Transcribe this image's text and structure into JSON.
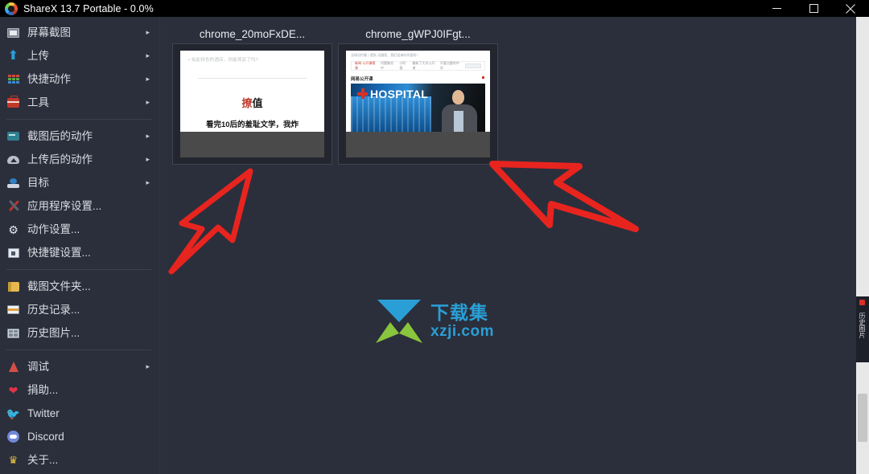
{
  "window": {
    "title": "ShareX 13.7 Portable - 0.0%",
    "app_icon": "sharex-logo-icon",
    "controls": {
      "minimize": "minimize-button",
      "maximize": "maximize-button",
      "close": "close-button"
    }
  },
  "sidebar": {
    "groups": [
      {
        "items": [
          {
            "label": "屏幕截图",
            "icon": "screenshot-icon",
            "submenu": true
          },
          {
            "label": "上传",
            "icon": "upload-arrow-icon",
            "submenu": true
          },
          {
            "label": "快捷动作",
            "icon": "quick-actions-grid-icon",
            "submenu": true
          },
          {
            "label": "工具",
            "icon": "toolbox-icon",
            "submenu": true
          }
        ]
      },
      {
        "items": [
          {
            "label": "截图后的动作",
            "icon": "after-capture-tag-icon",
            "submenu": true
          },
          {
            "label": "上传后的动作",
            "icon": "after-upload-cloud-icon",
            "submenu": true
          },
          {
            "label": "目标",
            "icon": "destination-icon",
            "submenu": true
          },
          {
            "label": "应用程序设置...",
            "icon": "app-settings-tools-icon",
            "submenu": false
          },
          {
            "label": "动作设置...",
            "icon": "task-settings-gear-icon",
            "submenu": false
          },
          {
            "label": "快捷键设置...",
            "icon": "hotkey-settings-keyboard-icon",
            "submenu": false
          }
        ]
      },
      {
        "items": [
          {
            "label": "截图文件夹...",
            "icon": "screenshots-folder-icon",
            "submenu": false
          },
          {
            "label": "历史记录...",
            "icon": "history-icon",
            "submenu": false
          },
          {
            "label": "历史图片...",
            "icon": "image-history-icon",
            "submenu": false
          }
        ]
      },
      {
        "items": [
          {
            "label": "调试",
            "icon": "debug-cone-icon",
            "submenu": true
          },
          {
            "label": "捐助...",
            "icon": "donate-heart-icon",
            "submenu": false
          },
          {
            "label": "Twitter",
            "icon": "twitter-icon",
            "submenu": false
          },
          {
            "label": "Discord",
            "icon": "discord-icon",
            "submenu": false
          },
          {
            "label": "关于...",
            "icon": "about-crown-icon",
            "submenu": false
          }
        ]
      }
    ],
    "arrow_glyph": "▸"
  },
  "main": {
    "thumbnails": [
      {
        "title": "chrome_20moFxDE...",
        "page": {
          "top_line": "• 如此特色的酒店，你能驾驭了吗?",
          "headline_red": "撩",
          "headline_dark": "值",
          "caption": "看完10后的羞耻文学，我炸"
        }
      },
      {
        "title": "chrome_gWPJ0IFgt...",
        "page": {
          "top_line": "全球治疗最丨遗失·远路医、我们迎来时间里的?",
          "nav_active": "新闻·公开课视频",
          "nav_items": [
            "问题聚合中",
            "小时报",
            "最新了大学公开课",
            "不要点题的中学"
          ],
          "section": "网易公开课",
          "hero_word": "HOSPITAL"
        }
      }
    ],
    "annotations": [
      {
        "name": "red-arrow-left",
        "direction": "up-right",
        "color": "#e8241f"
      },
      {
        "name": "red-arrow-right",
        "direction": "up-left",
        "color": "#e8241f"
      }
    ],
    "watermark": {
      "cn": "下载集",
      "url": "xzji.com",
      "logo_colors": {
        "top": "#2a9fd6",
        "bottom": "#8ac53e"
      }
    }
  },
  "right_edge": {
    "vertical_text": "历史图片",
    "badge_color": "#d93025"
  },
  "colors": {
    "titlebar_bg": "#000000",
    "window_bg": "#2b2f3b",
    "text": "#d9dce3",
    "accent_red": "#e8241f",
    "accent_blue": "#2a9fd6"
  }
}
